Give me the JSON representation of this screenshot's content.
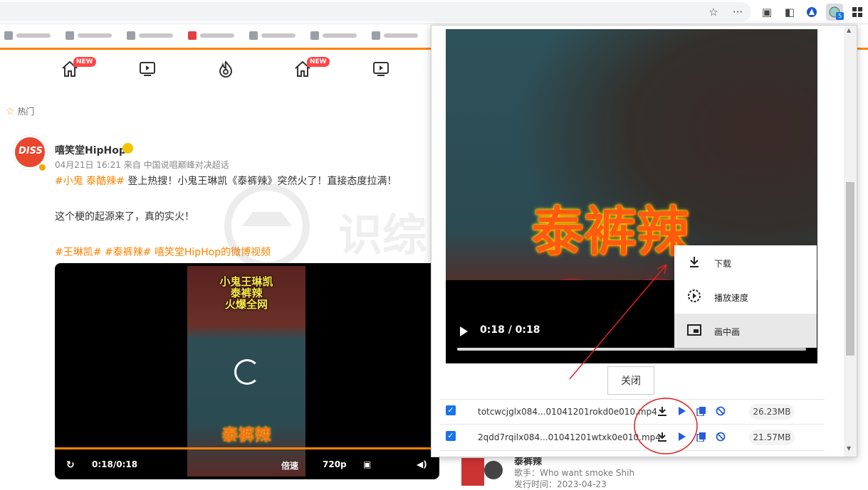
{
  "browser": {
    "icons": [
      "star-icon",
      "more-icon",
      "collections-icon",
      "extension-icon",
      "blue-shape-icon",
      "active-extension-icon",
      "apps-grid-icon"
    ],
    "ext_badge": "5"
  },
  "feed": {
    "nav_new_badge": "NEW",
    "hot_label": "热门",
    "post": {
      "user": "嘻笑堂HipHop",
      "avatar_text": "DISS",
      "meta": "04月21日 16:21  来自 中国说唱巅峰对决超话",
      "line1_tag": "#小鬼 泰酷辣#",
      "line1_rest": " 登上热搜！小鬼王琳凯《泰裤辣》突然火了！直接态度拉满！",
      "line2": "这个梗的起源来了，真的实火！",
      "line3": "#王琳凯# #泰裤辣# 嘻笑堂HipHop的微博视频",
      "video": {
        "caption": [
          "小鬼王琳凯",
          "泰裤辣",
          "火爆全网"
        ],
        "bottom_text": "泰裤辣",
        "time": "0:18/0:18",
        "speed": "倍速",
        "quality": "720p",
        "progress": 1.0
      }
    },
    "music": {
      "title": "泰裤辣",
      "singer": "歌手：Who want smoke Shih",
      "date": "发行时间：2023-04-23"
    }
  },
  "popup": {
    "preview_title": "泰裤辣",
    "preview_time": "0:18 / 0:18",
    "preview_progress": 1.0,
    "menu": [
      {
        "label": "下载",
        "icon": "download-icon"
      },
      {
        "label": "播放速度",
        "icon": "playback-speed-icon"
      },
      {
        "label": "画中画",
        "icon": "picture-in-picture-icon"
      }
    ],
    "close_label": "关闭",
    "files": [
      {
        "name": "totcwcjglx084...01041201rokd0e010.mp4",
        "size": "26.23MB",
        "checked": true
      },
      {
        "name": "2qdd7rqilx084...01041201wtxk0e010.mp4",
        "size": "21.57MB",
        "checked": true
      }
    ],
    "colors": {
      "accent": "#1a73e8",
      "annotation": "#e02020",
      "brand": "#ff8200"
    }
  }
}
